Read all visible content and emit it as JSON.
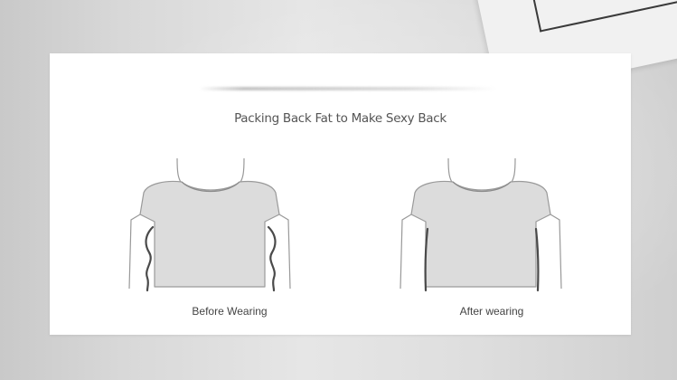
{
  "banner": {
    "title": "Packing Back Fat to Make Sexy Back"
  },
  "comparison": [
    {
      "label": "Before Wearing",
      "state": "before",
      "icon": "torso-bulging-outline-icon"
    },
    {
      "label": "After wearing",
      "state": "after",
      "icon": "torso-smooth-outline-icon"
    }
  ],
  "colors": {
    "panel": "#ffffff",
    "shirt_fill": "#dcdcdc",
    "outline": "#888888",
    "contour": "#4a4a4a",
    "text": "#555555"
  }
}
